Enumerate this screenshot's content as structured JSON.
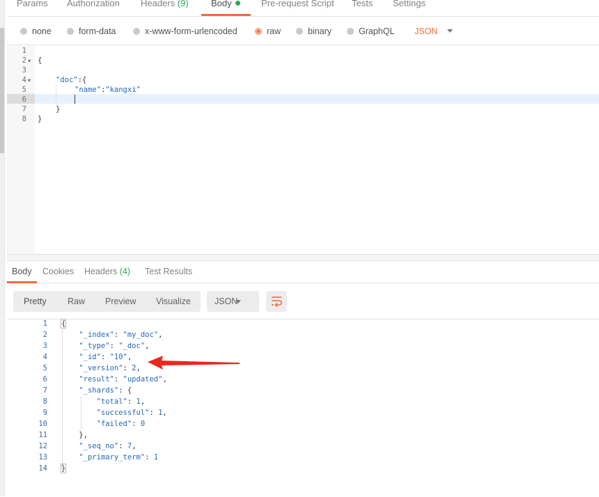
{
  "top_tabs": [
    {
      "label": "Params"
    },
    {
      "label": "Authorization"
    },
    {
      "label": "Headers",
      "count": "(9)"
    },
    {
      "label": "Body"
    },
    {
      "label": "Pre-request Script"
    },
    {
      "label": "Tests"
    },
    {
      "label": "Settings"
    }
  ],
  "body_types": [
    "none",
    "form-data",
    "x-www-form-urlencoded",
    "raw",
    "binary",
    "GraphQL"
  ],
  "body_type_selected": "raw",
  "raw_format": "JSON",
  "request_line_numbers": [
    "1",
    "2",
    "3",
    "4",
    "5",
    "6",
    "7",
    "8"
  ],
  "request_code": {
    "l2": "{",
    "l4_key": "\"doc\"",
    "l4_rest": ":{",
    "l5_key": "\"name\"",
    "l5_colon": ":",
    "l5_val": "\"kangxi\"",
    "l7": "}",
    "l8": "}"
  },
  "response_tabs": [
    {
      "label": "Body"
    },
    {
      "label": "Cookies"
    },
    {
      "label": "Headers",
      "count": "(4)"
    },
    {
      "label": "Test Results"
    }
  ],
  "view_modes": [
    "Pretty",
    "Raw",
    "Preview",
    "Visualize"
  ],
  "response_format": "JSON",
  "response_line_numbers": [
    "1",
    "2",
    "3",
    "4",
    "5",
    "6",
    "7",
    "8",
    "9",
    "10",
    "11",
    "12",
    "13",
    "14"
  ],
  "response_lines": [
    {
      "indent": "",
      "key": "",
      "sep": "",
      "val": "{",
      "brace": true
    },
    {
      "indent": "    ",
      "key": "\"_index\"",
      "sep": ": ",
      "val": "\"my_doc\"",
      "tail": ","
    },
    {
      "indent": "    ",
      "key": "\"_type\"",
      "sep": ": ",
      "val": "\"_doc\"",
      "tail": ","
    },
    {
      "indent": "    ",
      "key": "\"_id\"",
      "sep": ": ",
      "val": "\"10\"",
      "tail": ","
    },
    {
      "indent": "    ",
      "key": "\"_version\"",
      "sep": ": ",
      "val": "2",
      "tail": ","
    },
    {
      "indent": "    ",
      "key": "\"result\"",
      "sep": ": ",
      "val": "\"updated\"",
      "tail": ","
    },
    {
      "indent": "    ",
      "key": "\"_shards\"",
      "sep": ": ",
      "val": "{",
      "tail": ""
    },
    {
      "indent": "        ",
      "key": "\"total\"",
      "sep": ": ",
      "val": "1",
      "tail": ","
    },
    {
      "indent": "        ",
      "key": "\"successful\"",
      "sep": ": ",
      "val": "1",
      "tail": ","
    },
    {
      "indent": "        ",
      "key": "\"failed\"",
      "sep": ": ",
      "val": "0",
      "tail": ""
    },
    {
      "indent": "    ",
      "key": "",
      "sep": "",
      "val": "},",
      "tail": ""
    },
    {
      "indent": "    ",
      "key": "\"_seq_no\"",
      "sep": ": ",
      "val": "7",
      "tail": ","
    },
    {
      "indent": "    ",
      "key": "\"_primary_term\"",
      "sep": ": ",
      "val": "1",
      "tail": ""
    },
    {
      "indent": "",
      "key": "",
      "sep": "",
      "val": "}",
      "brace": true
    }
  ],
  "colors": {
    "accent": "#f26b3a",
    "count_green": "#2fa655",
    "annotation_arrow": "#e8281e"
  }
}
